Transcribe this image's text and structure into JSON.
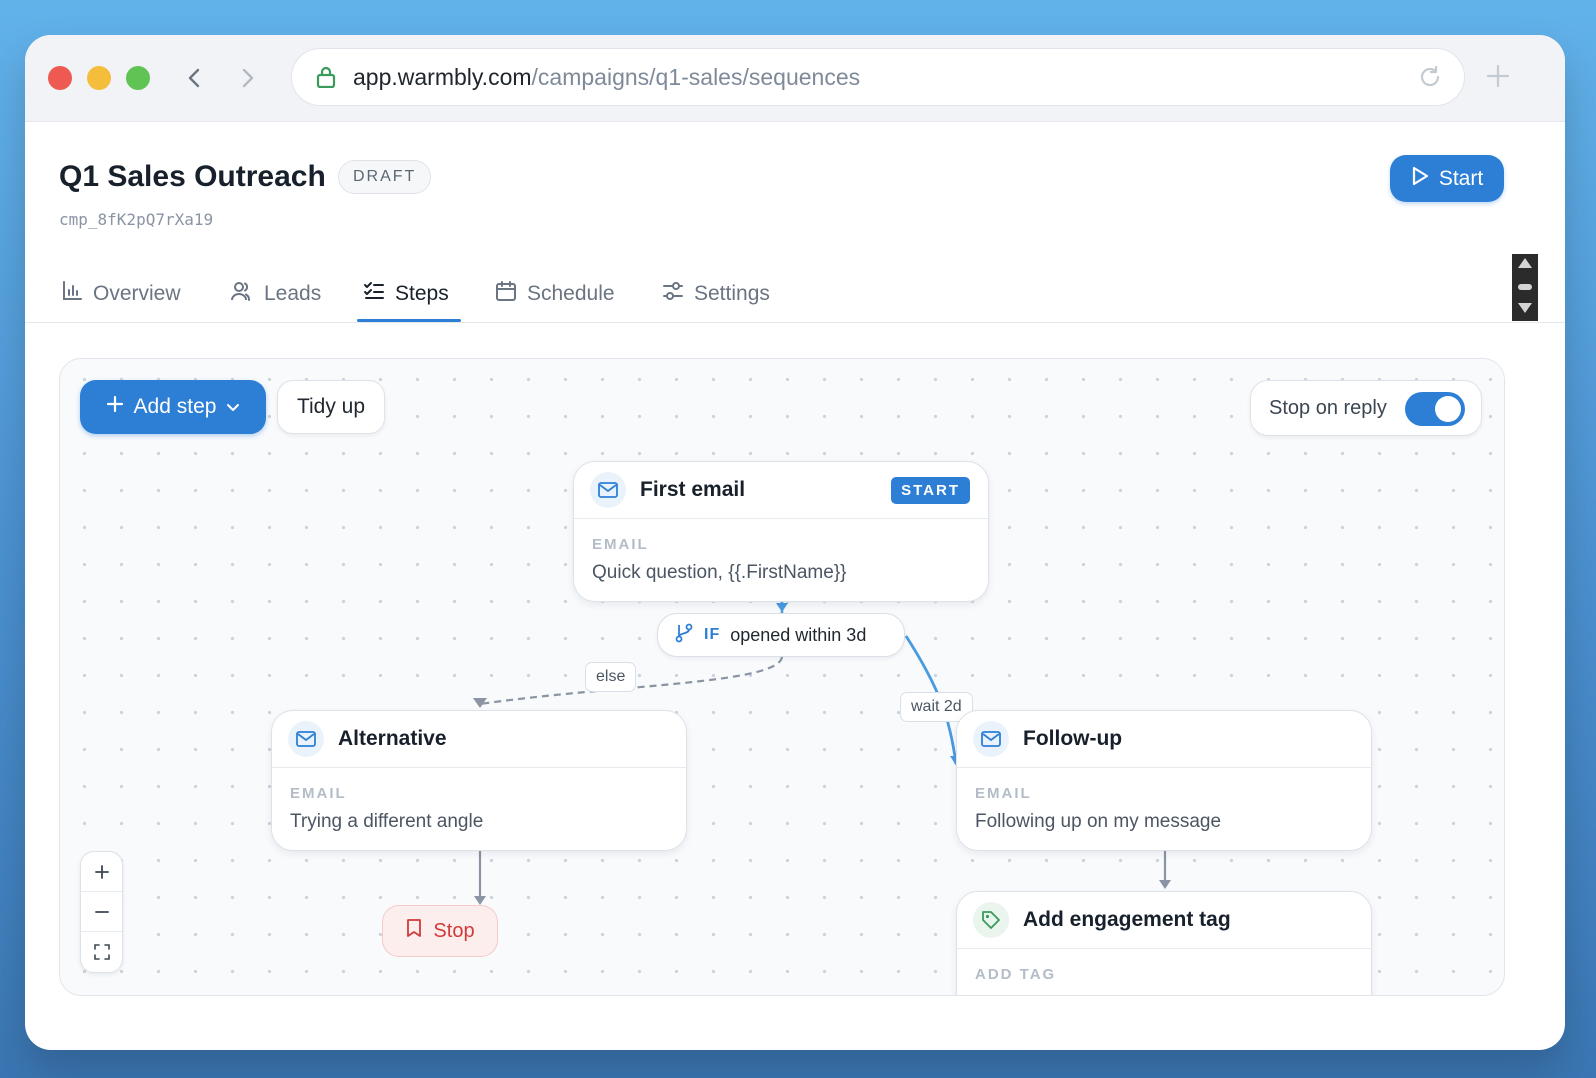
{
  "browser": {
    "url_host": "app.warmbly.com",
    "url_path": "/campaigns/q1-sales/sequences"
  },
  "header": {
    "title": "Q1 Sales Outreach",
    "status_badge": "DRAFT",
    "campaign_id": "cmp_8fK2pQ7rXa19",
    "start_label": "Start"
  },
  "tabs": [
    {
      "label": "Overview",
      "icon": "bar-chart-icon",
      "active": false
    },
    {
      "label": "Leads",
      "icon": "users-icon",
      "active": false
    },
    {
      "label": "Steps",
      "icon": "list-check-icon",
      "active": true
    },
    {
      "label": "Schedule",
      "icon": "calendar-icon",
      "active": false
    },
    {
      "label": "Settings",
      "icon": "sliders-icon",
      "active": false
    }
  ],
  "toolbar": {
    "add_step_label": "Add step",
    "tidy_label": "Tidy up",
    "stop_on_reply_label": "Stop on reply",
    "stop_on_reply_enabled": true
  },
  "nodes": {
    "first": {
      "title": "First email",
      "tag": "START",
      "kind": "EMAIL",
      "subject": "Quick question, {{.FirstName}}"
    },
    "condition": {
      "prefix": "IF",
      "text": "opened within 3d"
    },
    "alternative": {
      "title": "Alternative",
      "kind": "EMAIL",
      "subject": "Trying a different angle"
    },
    "followup": {
      "title": "Follow-up",
      "kind": "EMAIL",
      "subject": "Following up on my message"
    },
    "tag": {
      "title": "Add engagement tag",
      "kind": "ADD TAG"
    },
    "stop": {
      "label": "Stop"
    }
  },
  "edges": {
    "else_label": "else",
    "wait_label": "wait 2d"
  },
  "zoom_controls": [
    "zoom-in",
    "zoom-out",
    "fit-view"
  ],
  "colors": {
    "accent": "#2d7fd6",
    "stop_red": "#d23939",
    "tag_green": "#3a9a5b"
  }
}
